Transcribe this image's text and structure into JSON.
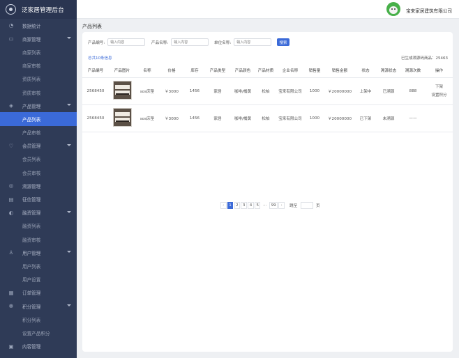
{
  "app": {
    "title": "泛家居管理后台"
  },
  "header": {
    "company": "宝来家居建筑有限公司"
  },
  "sidebar": {
    "items": [
      {
        "label": "数据统计",
        "icon": "chart-icon",
        "level": "top",
        "caret": false,
        "active": false
      },
      {
        "label": "商家管理",
        "icon": "store-icon",
        "level": "top",
        "caret": true,
        "active": false
      },
      {
        "label": "商家列表",
        "level": "sub",
        "active": false
      },
      {
        "label": "商家审核",
        "level": "sub",
        "active": false
      },
      {
        "label": "资质列表",
        "level": "sub",
        "active": false
      },
      {
        "label": "资质审核",
        "level": "sub",
        "active": false
      },
      {
        "label": "产品管理",
        "icon": "layers-icon",
        "level": "top",
        "caret": true,
        "active": false
      },
      {
        "label": "产品列表",
        "level": "sub",
        "active": true
      },
      {
        "label": "产品审核",
        "level": "sub",
        "active": false
      },
      {
        "label": "会员管理",
        "icon": "member-icon",
        "level": "top",
        "caret": true,
        "active": false
      },
      {
        "label": "会员列表",
        "level": "sub",
        "active": false
      },
      {
        "label": "会员审核",
        "level": "sub",
        "active": false
      },
      {
        "label": "溯源管理",
        "icon": "trace-icon",
        "level": "top",
        "caret": false,
        "active": false
      },
      {
        "label": "征信管理",
        "icon": "card-icon",
        "level": "top",
        "caret": false,
        "active": false
      },
      {
        "label": "融资管理",
        "icon": "finance-icon",
        "level": "top",
        "caret": true,
        "active": false
      },
      {
        "label": "融资列表",
        "level": "sub",
        "active": false
      },
      {
        "label": "融资审核",
        "level": "sub",
        "active": false
      },
      {
        "label": "用户管理",
        "icon": "user-icon",
        "level": "top",
        "caret": true,
        "active": false
      },
      {
        "label": "用户列表",
        "level": "sub",
        "active": false
      },
      {
        "label": "用户设置",
        "level": "sub",
        "active": false
      },
      {
        "label": "订单管理",
        "icon": "order-icon",
        "level": "top",
        "caret": false,
        "active": false
      },
      {
        "label": "积分管理",
        "icon": "points-icon",
        "level": "top",
        "caret": true,
        "active": false
      },
      {
        "label": "积分列表",
        "level": "sub",
        "active": false
      },
      {
        "label": "设置产品积分",
        "level": "sub",
        "active": false
      },
      {
        "label": "内容管理",
        "icon": "content-icon",
        "level": "top",
        "caret": false,
        "active": false
      }
    ]
  },
  "page": {
    "title": "产品列表"
  },
  "filters": {
    "code_label": "产品编号:",
    "code_placeholder": "输入内容",
    "name_label": "产品名称:",
    "name_placeholder": "输入内容",
    "unit_label": "单位名称:",
    "unit_placeholder": "输入内容",
    "search_label": "搜索"
  },
  "summary": {
    "left": "总共10条信息",
    "right": "已生成溯源码商品：25463"
  },
  "table": {
    "columns": [
      "产品编号",
      "产品图片",
      "名称",
      "价格",
      "库存",
      "产品类型",
      "产品颜色",
      "产品材质",
      "企业名称",
      "销售量",
      "销售金额",
      "状态",
      "溯源状态",
      "溯源次数",
      "操作"
    ],
    "rows": [
      {
        "code": "2568450",
        "name": "sos床垫",
        "price": "￥3000",
        "stock": "1456",
        "type": "家居",
        "color": "咖啡/橘黄",
        "material": "松柏",
        "company": "宝来有限公司",
        "sales": "1000",
        "amount": "￥20000000",
        "status": "上架中",
        "trace_status": "已溯源",
        "trace_count": "888",
        "ops": [
          "下架",
          "设置积分"
        ]
      },
      {
        "code": "2568450",
        "name": "sos床垫",
        "price": "￥3000",
        "stock": "1456",
        "type": "家居",
        "color": "咖啡/橘黄",
        "material": "松柏",
        "company": "宝来有限公司",
        "sales": "1000",
        "amount": "￥20000000",
        "status": "已下架",
        "trace_status": "未溯源",
        "trace_count": "——",
        "ops": []
      }
    ]
  },
  "pagination": {
    "prev": "‹",
    "pages": [
      "1",
      "2",
      "3",
      "4",
      "5"
    ],
    "dots": "···",
    "last": "99",
    "next": "›",
    "current": "1",
    "jump_label": "跳至",
    "jump_unit": "页"
  }
}
